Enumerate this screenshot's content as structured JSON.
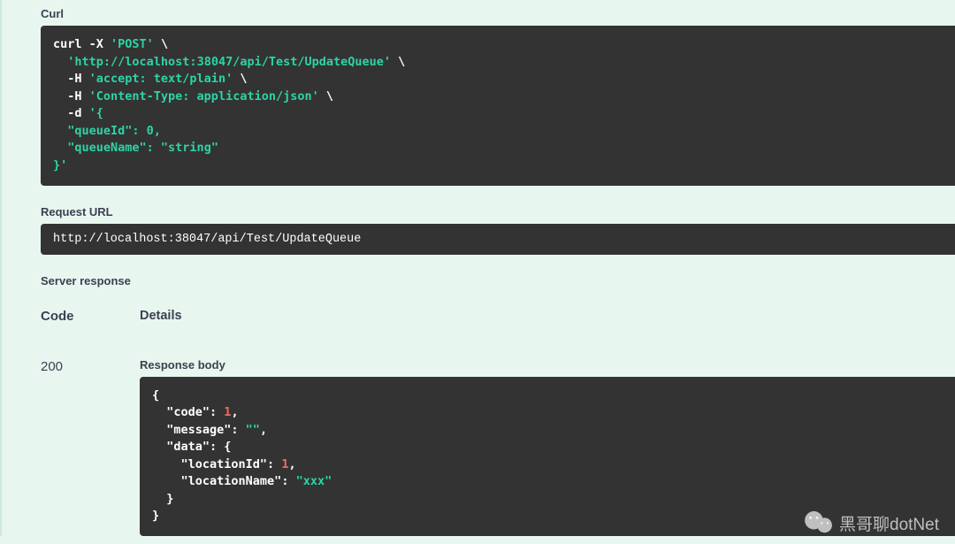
{
  "sections": {
    "curl_label": "Curl",
    "request_url_label": "Request URL",
    "server_response_label": "Server response",
    "code_header": "Code",
    "details_header": "Details",
    "response_body_label": "Response body"
  },
  "curl": {
    "command": "curl -X ",
    "method": "'POST'",
    "backslash": " \\",
    "url": "'http://localhost:38047/api/Test/UpdateQueue'",
    "h1_prefix": "  -H ",
    "h1": "'accept: text/plain'",
    "h2_prefix": "  -H ",
    "h2": "'Content-Type: application/json'",
    "d_prefix": "  -d ",
    "d_start": "'{",
    "body_k1": "  \"queueId\": ",
    "body_v1": "0",
    "body_k2": "  \"queueName\": ",
    "body_v2": "\"string\"",
    "d_end": "}'"
  },
  "request_url": "http://localhost:38047/api/Test/UpdateQueue",
  "response": {
    "status_code": "200",
    "body": {
      "open": "{",
      "k_code": "  \"code\"",
      "v_code": "1",
      "k_msg": "  \"message\"",
      "v_msg": "\"\"",
      "k_data": "  \"data\"",
      "data_open": "{",
      "k_loc_id": "    \"locationId\"",
      "v_loc_id": "1",
      "k_loc_name": "    \"locationName\"",
      "v_loc_name": "\"xxx\"",
      "data_close": "  }",
      "close": "}"
    }
  },
  "watermark": "黑哥聊dotNet"
}
